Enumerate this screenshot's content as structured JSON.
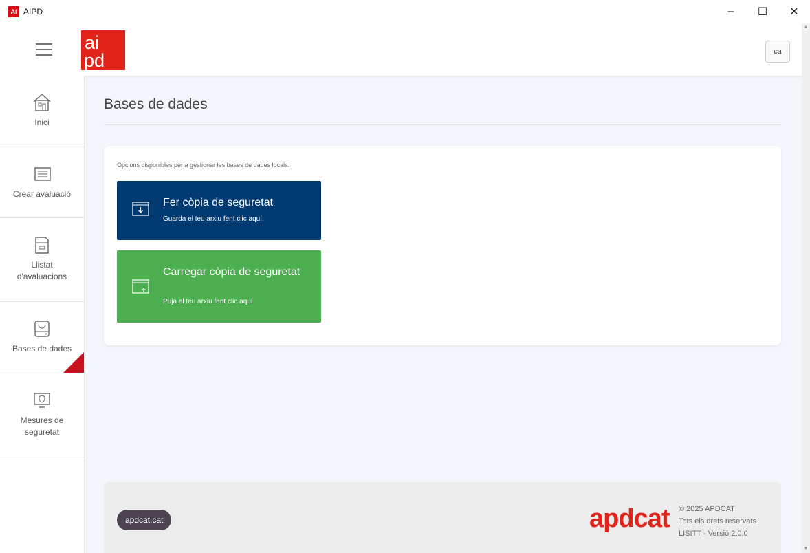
{
  "window": {
    "title": "AIPD",
    "icon_text": "AI"
  },
  "header": {
    "lang": "ca",
    "logo_alt": "aipd"
  },
  "sidebar": {
    "items": [
      {
        "label": "Inici",
        "icon": "home-icon"
      },
      {
        "label": "Crear avaluació",
        "icon": "document-icon"
      },
      {
        "label": "Llistat d'avaluacions",
        "icon": "folder-icon"
      },
      {
        "label": "Bases de dades",
        "icon": "database-icon",
        "active": true
      },
      {
        "label": "Mesures de seguretat",
        "icon": "monitor-shield-icon"
      }
    ]
  },
  "main": {
    "title": "Bases de dades",
    "description": "Opcions disponibles per a gestionar les bases de dades locals.",
    "backup": {
      "title": "Fer còpia de seguretat",
      "subtitle": "Guarda el teu arxiu fent clic aquí"
    },
    "restore": {
      "title": "Carregar còpia de seguretat",
      "subtitle": "Puja el teu arxiu fent clic aquí"
    }
  },
  "footer": {
    "link": "apdcat.cat",
    "brand": "apdcat",
    "copyright": "© 2025 APDCAT",
    "rights": "Tots els drets reservats",
    "version": "LISITT - Versió 2.0.0"
  },
  "colors": {
    "primary": "#003a70",
    "success": "#4caf50",
    "brand_red": "#e2231a",
    "active_marker": "#c8101e"
  }
}
